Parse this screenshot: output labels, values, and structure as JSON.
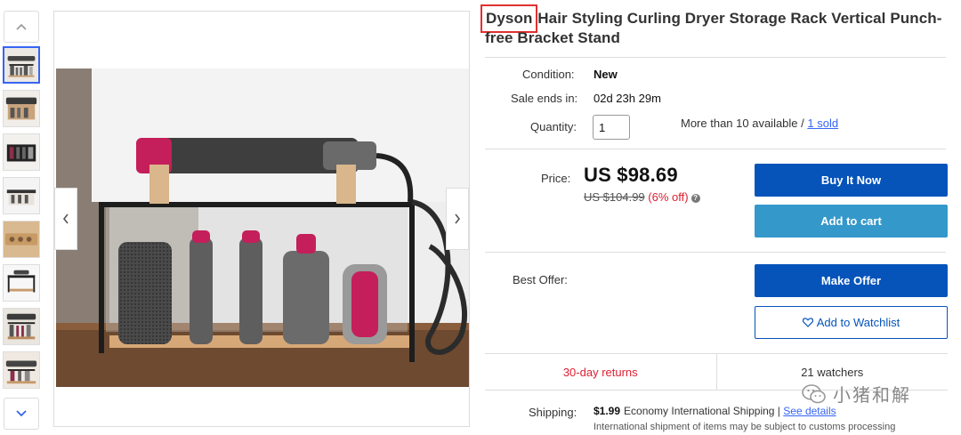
{
  "gallery": {
    "up_icon": "chevron-up-icon",
    "down_icon": "chevron-down-icon",
    "prev_icon": "chevron-left-icon",
    "next_icon": "chevron-right-icon",
    "thumbnail_count": 8,
    "active_thumbnail": 1
  },
  "listing": {
    "title_brand": "Dyson",
    "title_rest": " Hair Styling Curling Dryer Storage Rack Vertical Punch-free Bracket Stand",
    "condition_label": "Condition:",
    "condition_value": "New",
    "sale_ends_label": "Sale ends in:",
    "sale_ends_value": "02d 23h 29m",
    "quantity_label": "Quantity:",
    "quantity_value": "1",
    "availability_text": "More than 10 available / ",
    "sold_link": "1 sold"
  },
  "pricing": {
    "price_label": "Price:",
    "price": "US $98.69",
    "original_price": "US $104.99",
    "discount": " (6% off)",
    "info_icon": "info-icon"
  },
  "actions": {
    "buy_now": "Buy It Now",
    "add_to_cart": "Add to cart",
    "best_offer_label": "Best Offer:",
    "make_offer": "Make Offer",
    "watchlist": "Add to Watchlist",
    "watchlist_icon": "heart-icon"
  },
  "stats": {
    "returns": "30-day returns",
    "watchers": "21 watchers"
  },
  "shipping": {
    "label": "Shipping:",
    "cost": "$1.99",
    "method": "Economy International Shipping | ",
    "details_link": "See details",
    "note": "International shipment of items may be subject to customs processing"
  },
  "watermark": {
    "text": "小猪和解",
    "icon": "wechat-icon"
  },
  "colors": {
    "primary": "#0654ba",
    "secondary": "#3498ca",
    "discount": "#dd1e31",
    "highlight_box": "#e03030"
  }
}
